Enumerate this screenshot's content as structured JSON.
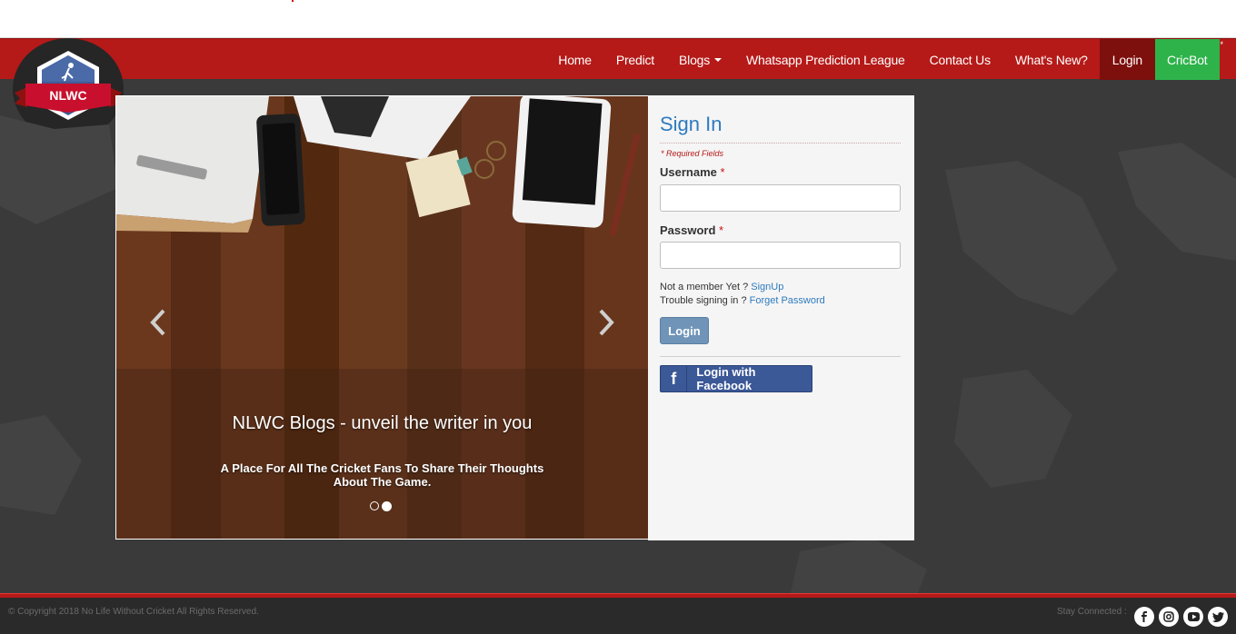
{
  "nav": {
    "items": [
      {
        "label": "Home"
      },
      {
        "label": "Predict"
      },
      {
        "label": "Blogs"
      },
      {
        "label": "Whatsapp Prediction League"
      },
      {
        "label": "Contact Us"
      },
      {
        "label": "What's New?"
      },
      {
        "label": "Login"
      },
      {
        "label": "CricBot"
      }
    ],
    "corner_mark": "*"
  },
  "logo": {
    "text": "NLWC"
  },
  "slider": {
    "title": "NLWC Blogs - unveil the writer in you",
    "subtitle": "A Place For All The Cricket Fans To Share Their Thoughts About The Game.",
    "active_slide": 2,
    "slide_count": 2
  },
  "signin": {
    "title": "Sign In",
    "required_note": "* Required Fields",
    "username_label": "Username",
    "password_label": "Password",
    "required_star": "*",
    "not_member_text": "Not a member Yet ?",
    "signup_link": "SignUp",
    "trouble_text": "Trouble signing in ?",
    "forget_link": "Forget Password",
    "login_button": "Login",
    "facebook_button": "Login with Facebook",
    "facebook_glyph": "f"
  },
  "footer": {
    "copyright": "© Copyright 2018 No Life Without Cricket All Rights Reserved.",
    "stay_connected": "Stay Connected :"
  },
  "colors": {
    "nav_red": "#b51a18",
    "nav_active": "#7d0f0d",
    "cricbot_green": "#2db34a",
    "signin_blue": "#2e7bbf",
    "facebook_blue": "#3b5897"
  },
  "icons": [
    "chevron-left-icon",
    "chevron-right-icon",
    "facebook-icon",
    "instagram-icon",
    "youtube-icon",
    "twitter-icon"
  ]
}
